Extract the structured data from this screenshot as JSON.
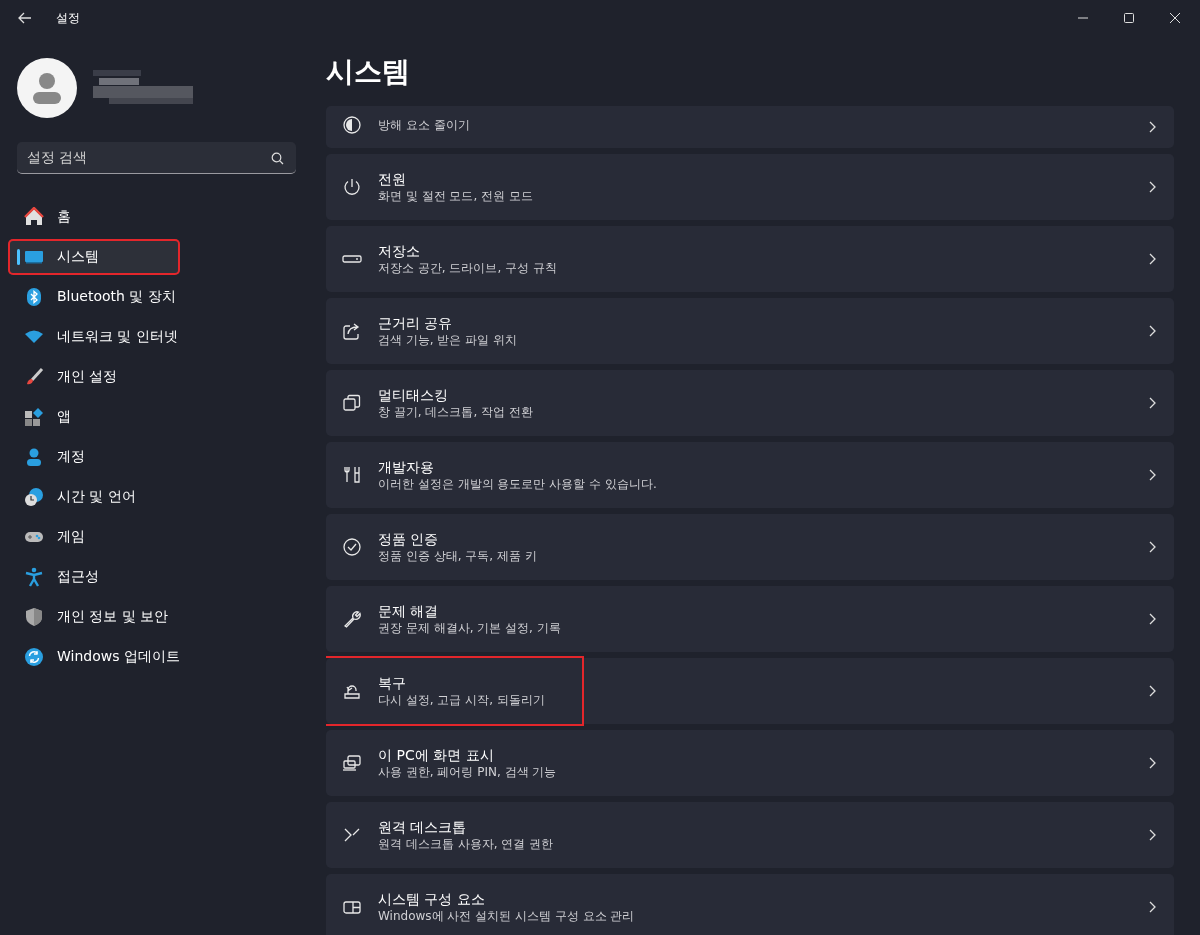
{
  "window": {
    "title": "설정"
  },
  "search": {
    "placeholder": "설정 검색"
  },
  "sidebar": {
    "items": [
      {
        "label": "홈",
        "selected": false,
        "highlighted": false
      },
      {
        "label": "시스템",
        "selected": true,
        "highlighted": true
      },
      {
        "label": "Bluetooth 및 장치",
        "selected": false,
        "highlighted": false
      },
      {
        "label": "네트워크 및 인터넷",
        "selected": false,
        "highlighted": false
      },
      {
        "label": "개인 설정",
        "selected": false,
        "highlighted": false
      },
      {
        "label": "앱",
        "selected": false,
        "highlighted": false
      },
      {
        "label": "계정",
        "selected": false,
        "highlighted": false
      },
      {
        "label": "시간 및 언어",
        "selected": false,
        "highlighted": false
      },
      {
        "label": "게임",
        "selected": false,
        "highlighted": false
      },
      {
        "label": "접근성",
        "selected": false,
        "highlighted": false
      },
      {
        "label": "개인 정보 및 보안",
        "selected": false,
        "highlighted": false
      },
      {
        "label": "Windows 업데이트",
        "selected": false,
        "highlighted": false
      }
    ]
  },
  "page": {
    "title": "시스템"
  },
  "settings": [
    {
      "subtitle": "방해 요소 줄이기",
      "highlighted": false
    },
    {
      "title": "전원",
      "subtitle": "화면 및 절전 모드, 전원 모드",
      "highlighted": false
    },
    {
      "title": "저장소",
      "subtitle": "저장소 공간, 드라이브, 구성 규칙",
      "highlighted": false
    },
    {
      "title": "근거리 공유",
      "subtitle": "검색 기능, 받은 파일 위치",
      "highlighted": false
    },
    {
      "title": "멀티태스킹",
      "subtitle": "창 끌기, 데스크톱, 작업 전환",
      "highlighted": false
    },
    {
      "title": "개발자용",
      "subtitle": "이러한 설정은 개발의 용도로만 사용할 수 있습니다.",
      "highlighted": false
    },
    {
      "title": "정품 인증",
      "subtitle": "정품 인증 상태, 구독, 제품 키",
      "highlighted": false
    },
    {
      "title": "문제 해결",
      "subtitle": "권장 문제 해결사, 기본 설정, 기록",
      "highlighted": false
    },
    {
      "title": "복구",
      "subtitle": "다시 설정, 고급 시작, 되돌리기",
      "highlighted": true
    },
    {
      "title": "이 PC에 화면 표시",
      "subtitle": "사용 권한, 페어링 PIN, 검색 기능",
      "highlighted": false
    },
    {
      "title": "원격 데스크톱",
      "subtitle": "원격 데스크톱 사용자, 연결 권한",
      "highlighted": false
    },
    {
      "title": "시스템 구성 요소",
      "subtitle": "Windows에 사전 설치된 시스템 구성 요소 관리",
      "highlighted": false
    }
  ]
}
